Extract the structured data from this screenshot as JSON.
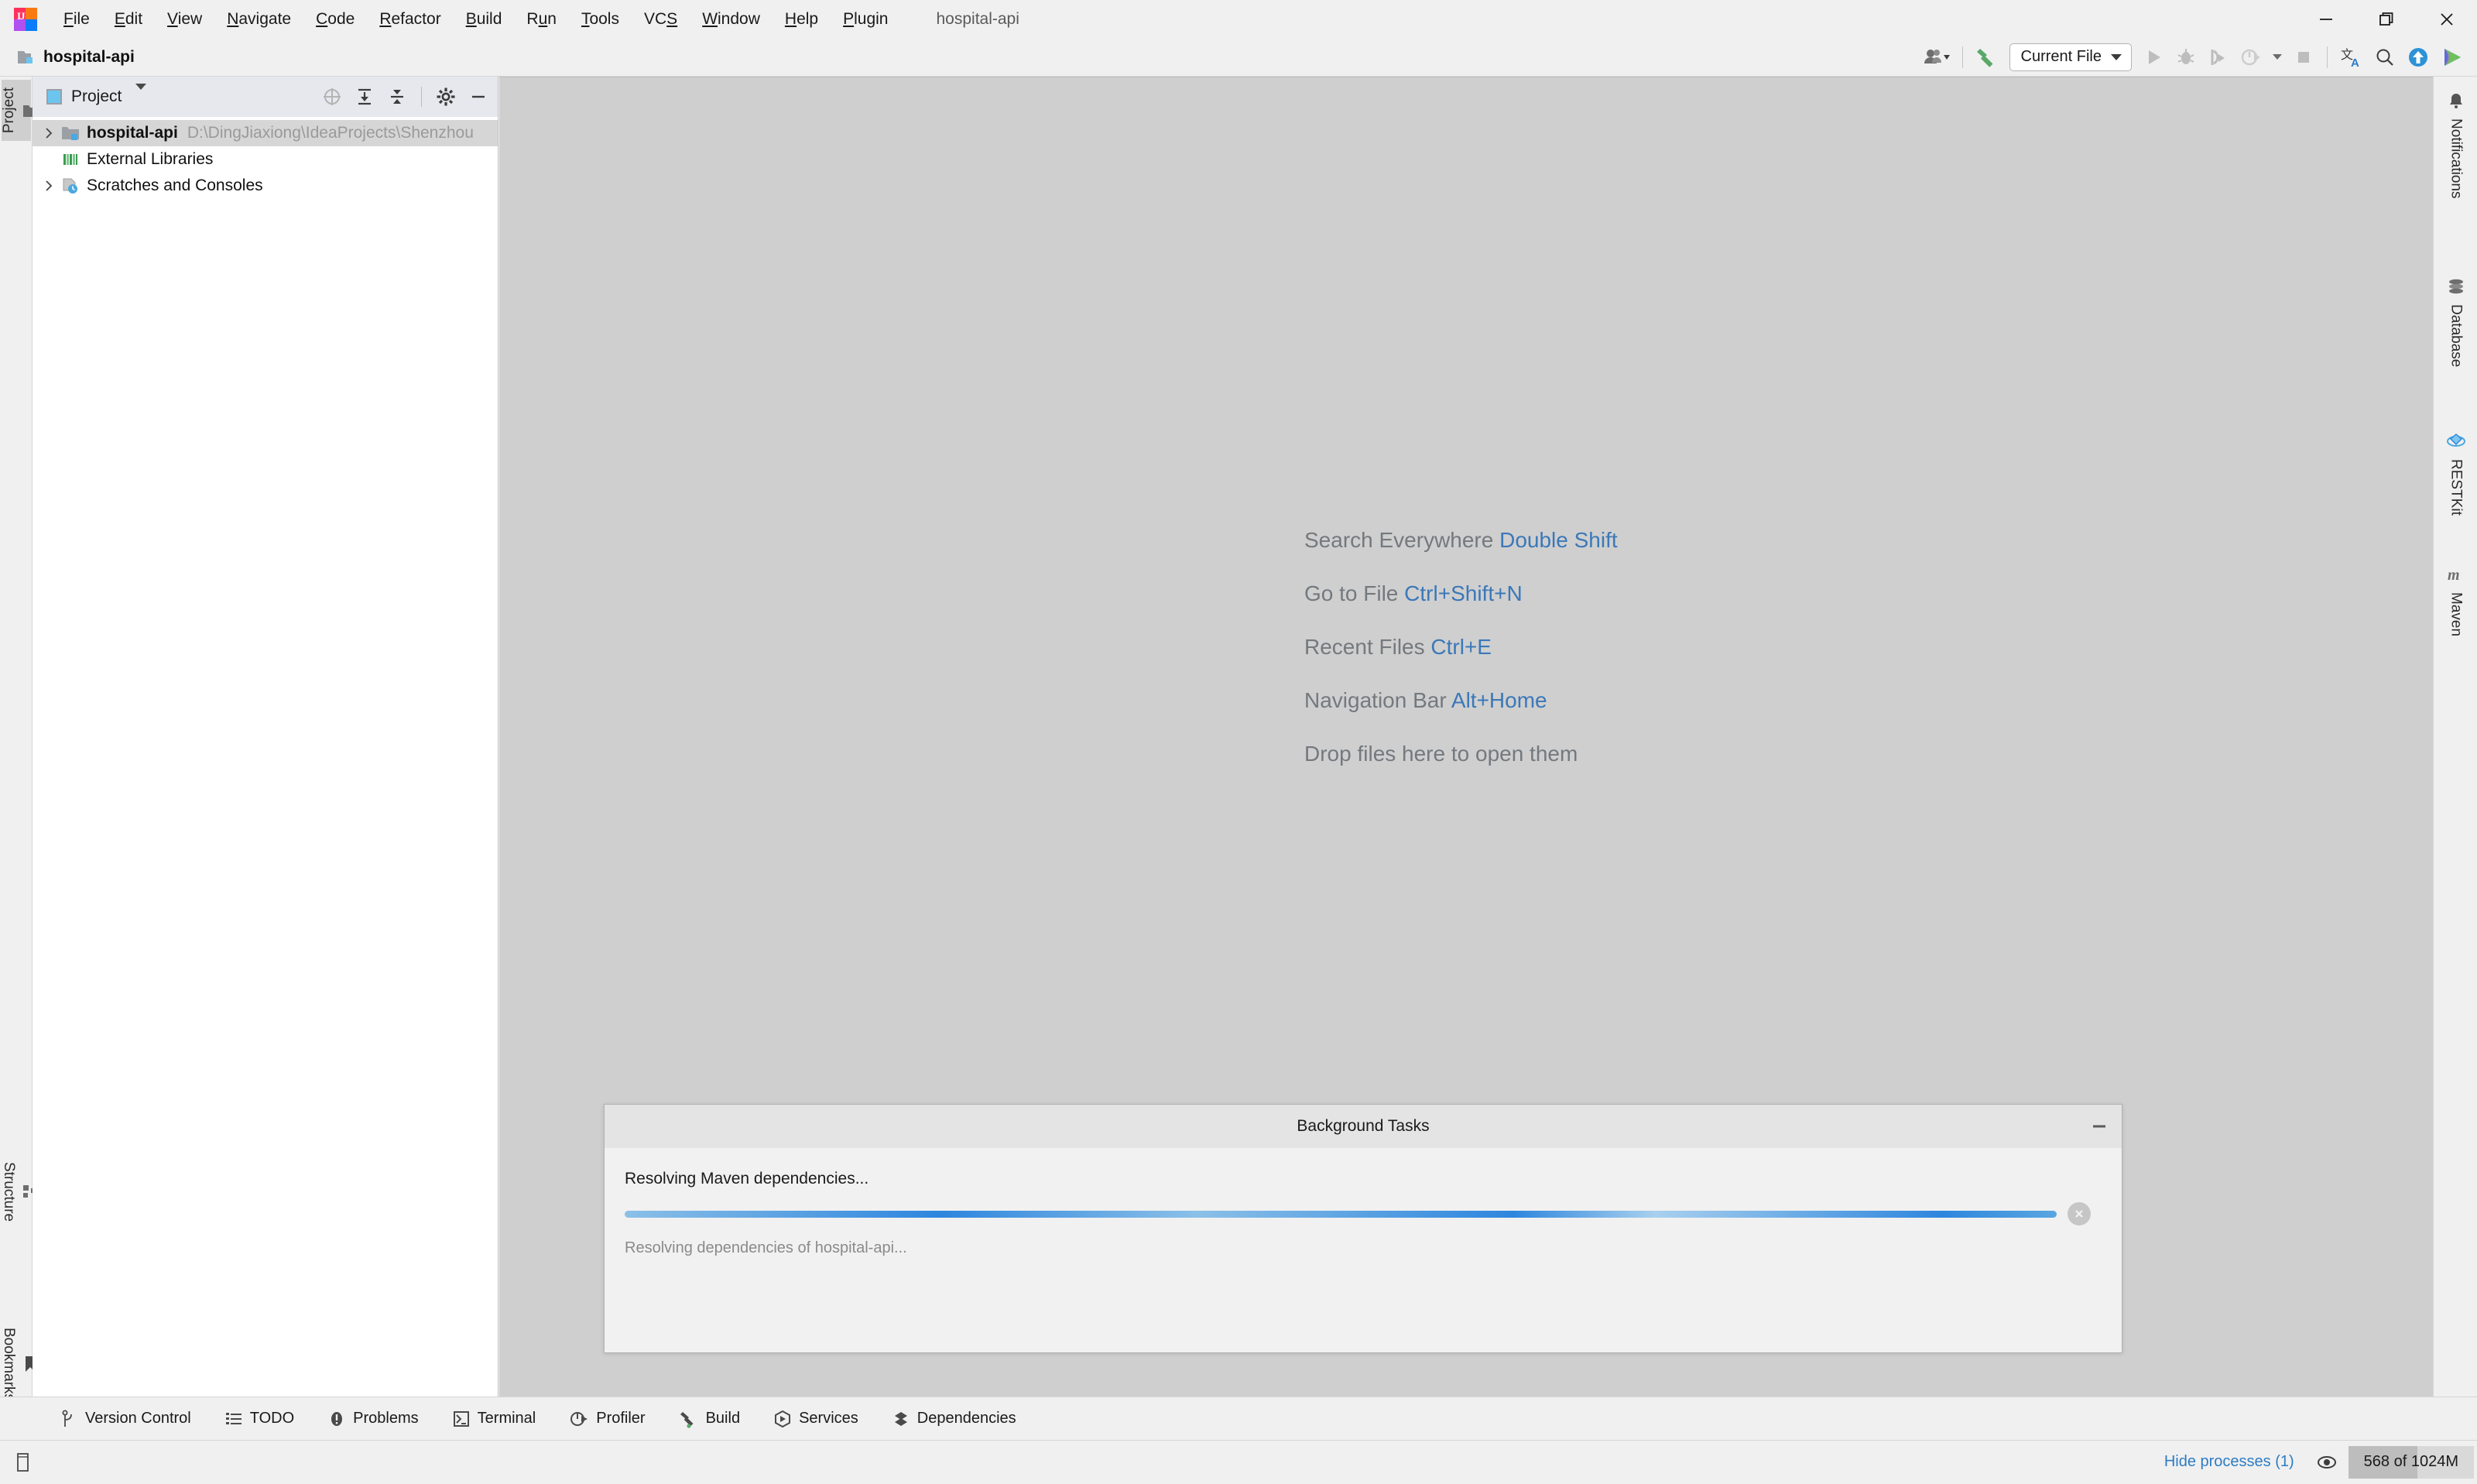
{
  "app": {
    "window_title": "hospital-api",
    "logo_label": "IJ"
  },
  "menubar": {
    "items": [
      {
        "label": "File",
        "mnemonic": "F"
      },
      {
        "label": "Edit",
        "mnemonic": "E"
      },
      {
        "label": "View",
        "mnemonic": "V"
      },
      {
        "label": "Navigate",
        "mnemonic": "N"
      },
      {
        "label": "Code",
        "mnemonic": "C"
      },
      {
        "label": "Refactor",
        "mnemonic": "R"
      },
      {
        "label": "Build",
        "mnemonic": "B"
      },
      {
        "label": "Run",
        "mnemonic": "u"
      },
      {
        "label": "Tools",
        "mnemonic": "T"
      },
      {
        "label": "VCS",
        "mnemonic": "S"
      },
      {
        "label": "Window",
        "mnemonic": "W"
      },
      {
        "label": "Help",
        "mnemonic": "H"
      },
      {
        "label": "Plugin",
        "mnemonic": "P"
      }
    ]
  },
  "window_controls": {
    "minimize": "minimize-icon",
    "maximize": "restore-icon",
    "close": "close-icon"
  },
  "project_bar": {
    "project_name": "hospital-api",
    "folder_icon": "project-folder-icon"
  },
  "toolbar": {
    "account_icon": "user-account-icon",
    "build_icon": "build-hammer-icon",
    "run_config": {
      "label": "Current File",
      "caret": "chevron-down-icon"
    },
    "run_icon": "run-play-icon",
    "debug_icon": "debug-bug-icon",
    "run_coverage_icon": "run-with-coverage-icon",
    "profile_icon": "profile-icon",
    "stop_icon": "stop-square-icon",
    "translate_icon": "translate-icon",
    "search_icon": "search-magnifier-icon",
    "update_icon": "update-arrow-icon",
    "ide_feature_icon": "ide-feature-icon"
  },
  "left_stripe": {
    "buttons": [
      {
        "label": "Project",
        "icon": "project-folder-icon",
        "active": true
      },
      {
        "label": "Structure",
        "icon": "structure-icon",
        "active": false
      },
      {
        "label": "Bookmarks",
        "icon": "bookmark-icon",
        "active": false
      }
    ]
  },
  "project_tool_window": {
    "title": "Project",
    "title_icon": "project-window-icon",
    "caret": "chevron-down-icon",
    "actions": [
      {
        "name": "select-opened-file-icon"
      },
      {
        "name": "expand-all-icon"
      },
      {
        "name": "collapse-all-icon"
      },
      {
        "name": "settings-gear-icon"
      },
      {
        "name": "hide-minimize-icon"
      }
    ],
    "tree": [
      {
        "label": "hospital-api",
        "path": "D:\\DingJiaxiong\\IdeaProjects\\Shenzhou",
        "icon": "module-folder-icon",
        "arrow": "chevron-right-icon",
        "bold": true,
        "selected": true,
        "indent": 0
      },
      {
        "label": "External Libraries",
        "path": "",
        "icon": "external-libraries-icon",
        "arrow": "",
        "bold": false,
        "selected": false,
        "indent": 1
      },
      {
        "label": "Scratches and Consoles",
        "path": "",
        "icon": "scratches-icon",
        "arrow": "chevron-right-icon",
        "bold": false,
        "selected": false,
        "indent": 0
      }
    ]
  },
  "editor": {
    "hints": [
      {
        "text": "Search Everywhere ",
        "key": "Double Shift"
      },
      {
        "text": "Go to File ",
        "key": "Ctrl+Shift+N"
      },
      {
        "text": "Recent Files ",
        "key": "Ctrl+E"
      },
      {
        "text": "Navigation Bar ",
        "key": "Alt+Home"
      },
      {
        "text": "Drop files here to open them",
        "key": ""
      }
    ]
  },
  "background_tasks": {
    "title": "Background Tasks",
    "minimize_icon": "minimize-icon",
    "task_title": "Resolving Maven dependencies...",
    "task_detail": "Resolving dependencies of hospital-api...",
    "cancel_icon": "cancel-circle-icon",
    "progress_indeterminate": true
  },
  "right_stripe": {
    "buttons": [
      {
        "label": "Notifications",
        "icon": "notifications-bell-icon"
      },
      {
        "label": "Database",
        "icon": "database-icon"
      },
      {
        "label": "RESTKit",
        "icon": "restkit-icon"
      },
      {
        "label": "Maven",
        "icon": "maven-m-icon"
      }
    ]
  },
  "bottom_bar": {
    "items": [
      {
        "label": "Version Control",
        "icon": "version-control-branch-icon"
      },
      {
        "label": "TODO",
        "icon": "todo-list-icon"
      },
      {
        "label": "Problems",
        "icon": "problems-warning-icon"
      },
      {
        "label": "Terminal",
        "icon": "terminal-icon"
      },
      {
        "label": "Profiler",
        "icon": "profiler-icon"
      },
      {
        "label": "Build",
        "icon": "build-hammer-icon"
      },
      {
        "label": "Services",
        "icon": "services-icon"
      },
      {
        "label": "Dependencies",
        "icon": "dependencies-icon"
      }
    ]
  },
  "status_bar": {
    "left_icon": "status-left-icon",
    "hide_processes": "Hide processes (1)",
    "eye_icon": "eye-icon",
    "memory": "568 of 1024M"
  },
  "colors": {
    "accent_blue": "#2d7cc4",
    "hint_key_blue": "#3b78b8",
    "progress_blue": "#2e86de",
    "editor_bg": "#cfcfcf",
    "panel_bg": "#f0f0f0",
    "tree_selected": "#d6d6d6"
  }
}
